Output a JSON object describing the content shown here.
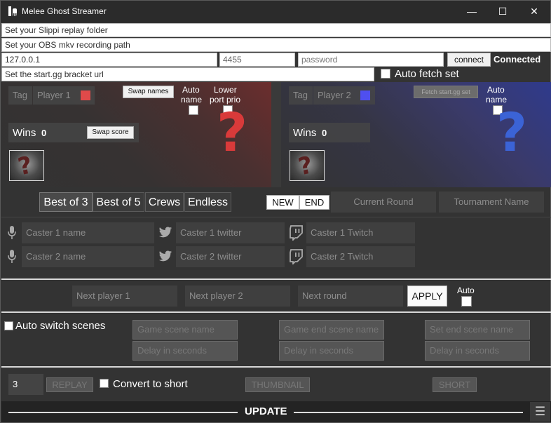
{
  "window": {
    "title": "Melee Ghost Streamer",
    "minimize": "—",
    "maximize": "☐",
    "close": "✕"
  },
  "top": {
    "slippi_placeholder": "Set your Slippi replay folder",
    "obs_placeholder": "Set your OBS mkv recording path",
    "ip_value": "127.0.0.1",
    "port_value": "4455",
    "password_placeholder": "password",
    "connect_label": "connect",
    "connection_status": "Connected",
    "bracket_placeholder": "Set the start.gg bracket url",
    "auto_fetch_label": "Auto fetch set"
  },
  "player1": {
    "tag_placeholder": "Tag",
    "name_placeholder": "Player 1",
    "color": "#e04a4a",
    "swap_names_label": "Swap names",
    "auto_name_label_1": "Auto",
    "auto_name_label_2": "name",
    "lower_port_label_1": "Lower",
    "lower_port_label_2": "port prio",
    "wins_label": "Wins",
    "wins_value": "0",
    "swap_score_label": "Swap score",
    "char_glyph": "?"
  },
  "player2": {
    "tag_placeholder": "Tag",
    "name_placeholder": "Player 2",
    "color": "#4f4ff0",
    "fetch_label": "Fetch start.gg set",
    "auto_name_label_1": "Auto",
    "auto_name_label_2": "name",
    "wins_label": "Wins",
    "wins_value": "0",
    "char_glyph": "?"
  },
  "match": {
    "tabs": [
      "Best of 3",
      "Best of 5",
      "Crews",
      "Endless"
    ],
    "new_label": "NEW",
    "end_label": "END",
    "round_placeholder": "Current Round",
    "tournament_placeholder": "Tournament Name"
  },
  "casters": {
    "caster1_name": "Caster 1 name",
    "caster1_twitter": "Caster 1 twitter",
    "caster1_twitch": "Caster 1 Twitch",
    "caster2_name": "Caster 2 name",
    "caster2_twitter": "Caster 2 twitter",
    "caster2_twitch": "Caster 2 Twitch"
  },
  "next": {
    "player1_placeholder": "Next player 1",
    "player2_placeholder": "Next player 2",
    "round_placeholder": "Next round",
    "apply_label": "APPLY",
    "auto_label": "Auto"
  },
  "scenes": {
    "auto_switch_label": "Auto switch scenes",
    "game_scene": "Game scene name",
    "game_end_scene": "Game end scene name",
    "set_end_scene": "Set end scene name",
    "delay1": "Delay in seconds",
    "delay2": "Delay in seconds",
    "delay3": "Delay in seconds"
  },
  "bottom": {
    "replay_count": "3",
    "replay_label": "REPLAY",
    "convert_label": "Convert to short",
    "thumbnail_label": "THUMBNAIL",
    "short_label": "SHORT",
    "update_label": "UPDATE",
    "menu_glyph": "☰"
  }
}
